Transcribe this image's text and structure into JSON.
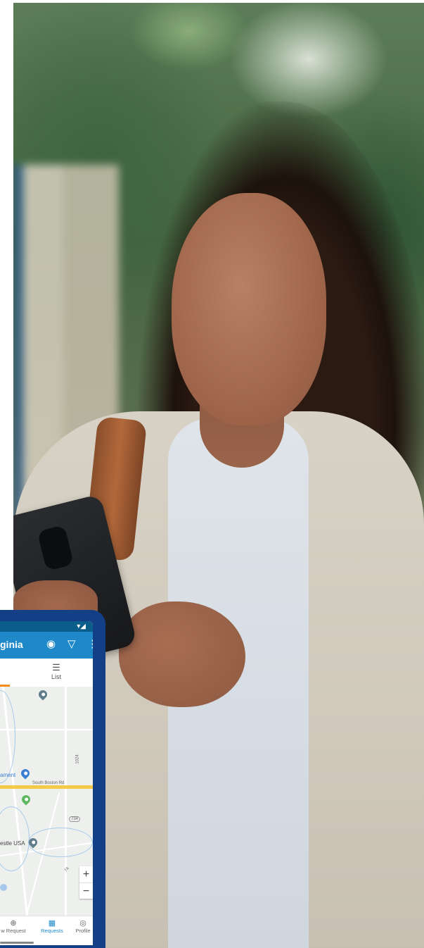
{
  "app": {
    "title": "ginia",
    "status_icons": "▾◢",
    "tabs": [
      {
        "label": "List",
        "icon": "list-icon",
        "glyph": "☰"
      }
    ],
    "map": {
      "road_labels": [
        "South Boston Rd",
        "1024",
        "734",
        "74"
      ],
      "poi_labels": [
        "ament",
        "estle USA"
      ]
    },
    "zoom": {
      "in": "+",
      "out": "−"
    },
    "bottom_nav": [
      {
        "label": "w Request",
        "icon": "plus-circle-icon",
        "glyph": "⊕"
      },
      {
        "label": "Requests",
        "icon": "requests-icon",
        "glyph": "▦"
      },
      {
        "label": "Profile",
        "icon": "profile-icon",
        "glyph": "◎"
      }
    ],
    "appbar_icons": {
      "locate": "◉",
      "filter": "▽",
      "more": "⋮"
    },
    "colors": {
      "frame": "#123f86",
      "appbar": "#1e88c9",
      "tab_indicator": "#f28c1b",
      "pin_blue": "#3b7fd3",
      "pin_green": "#5cb85c",
      "pin_slate": "#607d8b"
    }
  }
}
